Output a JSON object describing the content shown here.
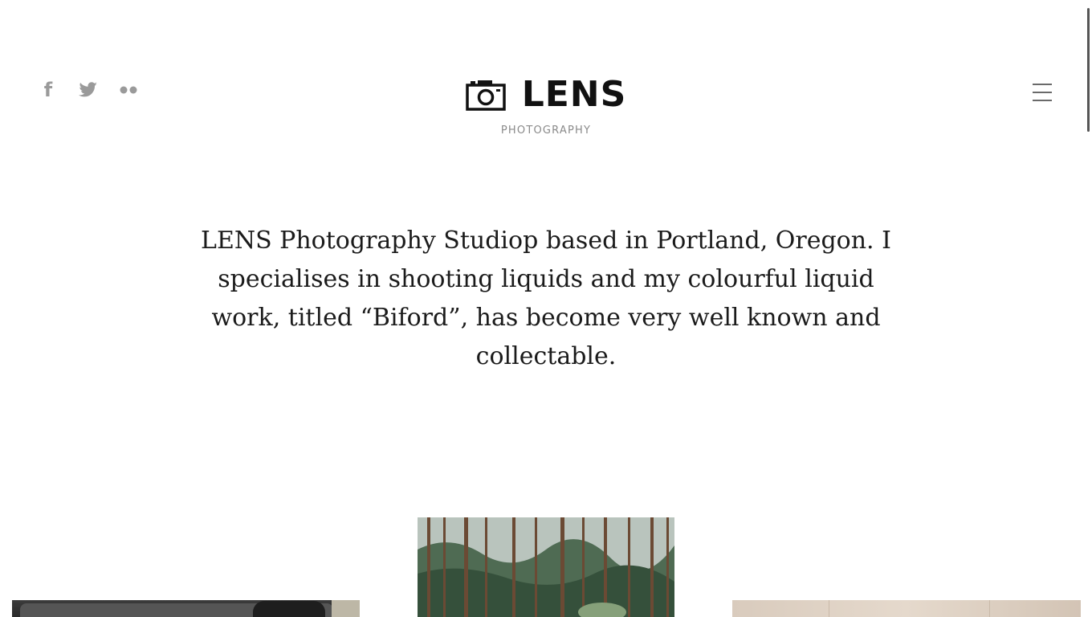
{
  "header": {
    "social": [
      {
        "name": "facebook-icon",
        "glyph": "f"
      },
      {
        "name": "twitter-icon"
      },
      {
        "name": "flickr-icon"
      }
    ],
    "logo": {
      "title": "LENS",
      "subtitle": "PHOTOGRAPHY"
    },
    "menu_icon": "hamburger-menu-icon"
  },
  "intro": {
    "text": "LENS Photography Studiop based in Portland, Oregon. I specialises in shooting liquids and my colourful liquid work, titled “Biford”, has become very well known and collectable."
  },
  "gallery": {
    "items": [
      {
        "name": "gallery-image-interior"
      },
      {
        "name": "gallery-image-forest"
      },
      {
        "name": "gallery-image-wall"
      }
    ]
  },
  "colors": {
    "text": "#1b1b1b",
    "muted": "#8a8a8a",
    "icon": "#9a9a9a",
    "background": "#ffffff"
  }
}
